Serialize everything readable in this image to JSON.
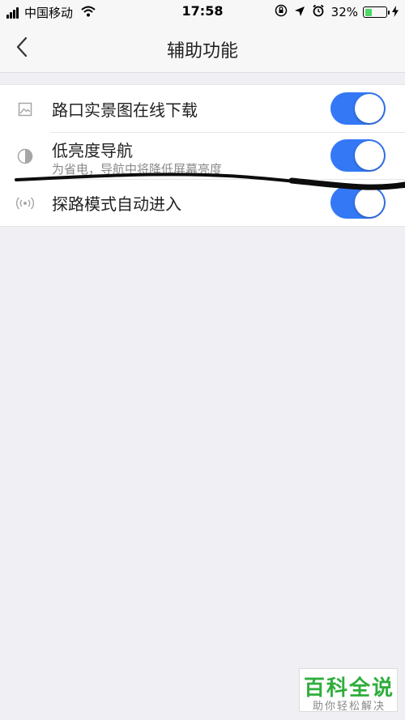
{
  "status_bar": {
    "carrier": "中国移动",
    "time": "17:58",
    "battery_percent": "32%",
    "battery_level": 0.32,
    "icons": [
      "signal-icon",
      "wifi-icon",
      "orientation-lock-icon",
      "location-arrow-icon",
      "alarm-icon",
      "battery-icon",
      "charging-bolt-icon"
    ]
  },
  "nav": {
    "title": "辅助功能",
    "back_icon": "chevron-left-icon"
  },
  "settings": {
    "items": [
      {
        "icon": "image-icon",
        "title": "路口实景图在线下载",
        "subtitle": "",
        "enabled": true
      },
      {
        "icon": "contrast-icon",
        "title": "低亮度导航",
        "subtitle": "为省电，导航中将降低屏幕亮度",
        "enabled": true
      },
      {
        "icon": "broadcast-icon",
        "title": "探路模式自动进入",
        "subtitle": "",
        "enabled": true
      }
    ]
  },
  "colors": {
    "toggle_on": "#3478f6",
    "background": "#efeff4",
    "watermark_green": "#2fae3c"
  },
  "watermark": {
    "logo": "百科全说",
    "tagline": "助你轻松解决"
  }
}
